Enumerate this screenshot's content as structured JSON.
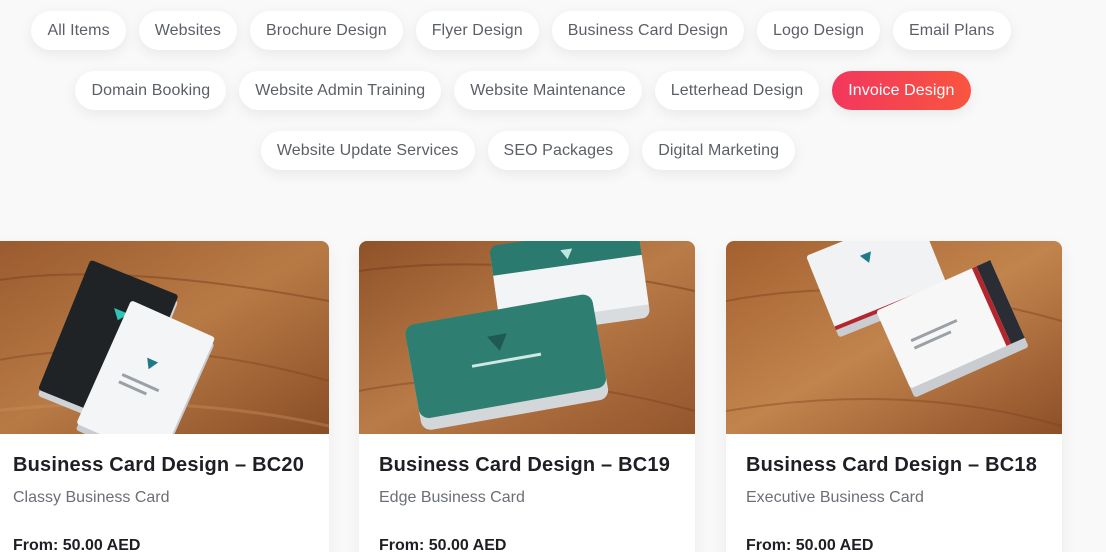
{
  "filters": {
    "row1": [
      "All Items",
      "Websites",
      "Brochure Design",
      "Flyer Design",
      "Business Card Design",
      "Logo Design",
      "Email Plans"
    ],
    "row2": [
      "Domain Booking",
      "Website Admin Training",
      "Website Maintenance",
      "Letterhead Design",
      "Invoice Design"
    ],
    "row3": [
      "Website Update Services",
      "SEO Packages",
      "Digital Marketing"
    ],
    "active": "Invoice Design"
  },
  "products": [
    {
      "title": "Business Card Design – BC20",
      "subtitle": "Classy Business Card",
      "price": "From: 50.00 AED",
      "image": "business-card-mockup-black-white"
    },
    {
      "title": "Business Card Design – BC19",
      "subtitle": "Edge Business Card",
      "price": "From: 50.00 AED",
      "image": "business-card-mockup-teal"
    },
    {
      "title": "Business Card Design – BC18",
      "subtitle": "Executive Business Card",
      "price": "From: 50.00 AED",
      "image": "business-card-mockup-red-white"
    }
  ],
  "colors": {
    "active_gradient_start": "#f2375e",
    "active_gradient_end": "#f9553f",
    "background": "#f9f9fa"
  }
}
